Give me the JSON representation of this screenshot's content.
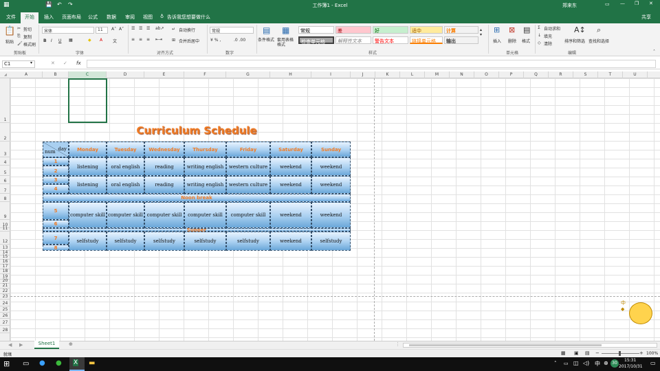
{
  "title_bar": {
    "title": "工作簿1 - Excel",
    "user": "郑来东"
  },
  "menu": {
    "tabs": [
      "文件",
      "开始",
      "插入",
      "页面布局",
      "公式",
      "数据",
      "审阅",
      "视图"
    ],
    "tell_me": "告诉我您想要做什么",
    "share": "共享"
  },
  "ribbon": {
    "clipboard": {
      "paste": "粘贴",
      "cut": "剪切",
      "copy": "复制",
      "format_painter": "格式刷",
      "label": "剪贴板"
    },
    "font": {
      "name": "宋体",
      "size": "11",
      "label": "字体",
      "bold": "B",
      "italic": "I",
      "underline": "U"
    },
    "alignment": {
      "wrap": "自动换行",
      "merge": "合并后居中",
      "label": "对齐方式"
    },
    "number": {
      "format": "常规",
      "label": "数字"
    },
    "styles": {
      "conditional": "条件格式",
      "table": "套用表格格式",
      "label": "样式",
      "items": [
        {
          "text": "常规",
          "bg": "#ffffff",
          "fg": "#000000"
        },
        {
          "text": "差",
          "bg": "#ffc7ce",
          "fg": "#9c0006"
        },
        {
          "text": "好",
          "bg": "#c6efce",
          "fg": "#006100"
        },
        {
          "text": "适中",
          "bg": "#ffeb9c",
          "fg": "#9c5700"
        },
        {
          "text": "计算",
          "bg": "#f2f2f2",
          "fg": "#fa7d00"
        },
        {
          "text": "检查单元格",
          "bg": "#a5a5a5",
          "fg": "#ffffff"
        },
        {
          "text": "解释性文本",
          "bg": "#ffffff",
          "fg": "#7f7f7f"
        },
        {
          "text": "警告文本",
          "bg": "#ffffff",
          "fg": "#ff0000"
        },
        {
          "text": "链接单元格",
          "bg": "#ffffff",
          "fg": "#fa7d00"
        },
        {
          "text": "输出",
          "bg": "#f2f2f2",
          "fg": "#3f3f3f"
        }
      ]
    },
    "cells": {
      "insert": "插入",
      "delete": "删除",
      "format": "格式",
      "label": "单元格"
    },
    "editing": {
      "autosum": "自动求和",
      "fill": "填充",
      "clear": "清除",
      "sort": "排序和筛选",
      "find": "查找和选择",
      "label": "编辑"
    }
  },
  "formula_bar": {
    "name_box": "C1",
    "fx": "fx",
    "content": ""
  },
  "columns": [
    "A",
    "B",
    "C",
    "D",
    "E",
    "F",
    "G",
    "H",
    "I",
    "J",
    "K",
    "L",
    "M",
    "N",
    "O",
    "P",
    "Q",
    "R",
    "S",
    "T",
    "U"
  ],
  "rows": [
    "1",
    "2",
    "3",
    "4",
    "5",
    "6",
    "7",
    "8",
    "9",
    "10",
    "11",
    "12",
    "13",
    "14",
    "15",
    "16",
    "17",
    "18",
    "19",
    "20",
    "21",
    "22",
    "23",
    "24",
    "25",
    "26",
    "27",
    "28"
  ],
  "schedule": {
    "title": "Curriculum Schedule",
    "corner_num": "num",
    "corner_day": "day",
    "days": [
      "Monday",
      "Tuesday",
      "Wednesday",
      "Thursday",
      "Friday",
      "Saturday",
      "Sunday"
    ],
    "block1": {
      "nums": [
        "1",
        "2"
      ],
      "cells": [
        "listening",
        "oral english",
        "reading",
        "writing english",
        "western culture",
        "weekend",
        "weekend"
      ]
    },
    "block2": {
      "nums": [
        "3",
        "4"
      ],
      "cells": [
        "listening",
        "oral english",
        "reading",
        "writing english",
        "western culture",
        "weekend",
        "weekend"
      ]
    },
    "noon": "Noon break",
    "block3": {
      "nums": [
        "5",
        "6"
      ],
      "cells": [
        "computer skill",
        "computer skill",
        "computer skill",
        "computer skill",
        "computer skill",
        "weekend",
        "weekend"
      ]
    },
    "supper": "Supper",
    "block4": {
      "nums": [
        "7",
        "8"
      ],
      "cells": [
        "selfstudy",
        "selfstudy",
        "selfstudy",
        "selfstudy",
        "selfstudy",
        "weekend",
        "selfstudy"
      ]
    }
  },
  "sheet_tabs": [
    "Sheet1"
  ],
  "status": {
    "ready": "就绪",
    "zoom": "100%"
  },
  "taskbar": {
    "time": "15:31",
    "date": "2017/10/31",
    "ime": "中",
    "badge": "30"
  },
  "colors": {
    "excel_green": "#217346",
    "header_orange": "#f07b24",
    "cell_blue": "#a9cff0"
  }
}
